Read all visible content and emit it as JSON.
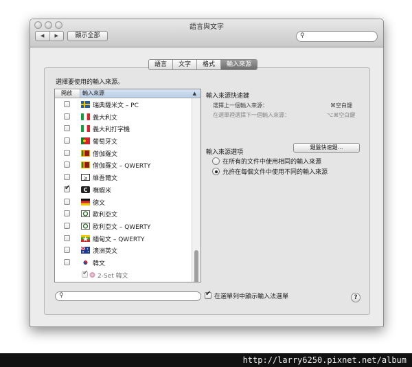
{
  "window": {
    "title": "語言與文字"
  },
  "toolbar": {
    "back_label": "◀",
    "forward_label": "▶",
    "show_all_label": "顯示全部",
    "search_placeholder": ""
  },
  "tabs": [
    "語言",
    "文字",
    "格式",
    "輸入來源"
  ],
  "active_tab": "輸入來源",
  "left": {
    "label": "選擇要使用的輸入來源。",
    "header": {
      "col_enabled": "開啟",
      "col_source": "輸入來源"
    },
    "items": [
      {
        "label": "瑞典薩米文 – PC",
        "checked": false,
        "flag": "sweden-flag"
      },
      {
        "label": "義大利文",
        "checked": false,
        "flag": "italy-flag"
      },
      {
        "label": "義大利打字機",
        "checked": false,
        "flag": "italy-flag"
      },
      {
        "label": "葡萄牙文",
        "checked": false,
        "flag": "portugal-flag"
      },
      {
        "label": "僧伽羅文",
        "checked": false,
        "flag": "sri-lanka-flag"
      },
      {
        "label": "僧伽羅文 – QWERTY",
        "checked": false,
        "flag": "sri-lanka-flag"
      },
      {
        "label": "維吾爾文",
        "checked": false,
        "flag": "uyghur-icon"
      },
      {
        "label": "嘸蝦米",
        "checked": true,
        "flag": "boshiamy-icon"
      },
      {
        "label": "德文",
        "checked": false,
        "flag": "germany-flag"
      },
      {
        "label": "歐利亞文",
        "checked": false,
        "flag": "oriya-icon"
      },
      {
        "label": "歐利亞文 – QWERTY",
        "checked": false,
        "flag": "oriya-icon"
      },
      {
        "label": "緬甸文 – QWERTY",
        "checked": false,
        "flag": "myanmar-flag"
      },
      {
        "label": "澳洲英文",
        "checked": false,
        "flag": "australia-flag"
      },
      {
        "label": "韓文",
        "checked": false,
        "flag": "korea-flag"
      },
      {
        "label": "2-Set 韓文",
        "checked": true,
        "flag": "korean-ime-icon",
        "sub": true
      }
    ]
  },
  "shortcuts": {
    "title": "輸入來源快速鍵",
    "prev_label": "選擇上一個輸入來源：",
    "prev_key": "⌘空白鍵",
    "next_label": "在選單裡選擇下一個輸入來源：",
    "next_key": "⌥⌘空白鍵",
    "button_label": "鍵盤快速鍵…"
  },
  "options": {
    "title": "輸入來源選項",
    "radio_same": "在所有的文件中使用相同的輸入來源",
    "radio_diff": "允許在每個文件中使用不同的輸入來源",
    "selected": "radio_diff"
  },
  "bottom": {
    "search_placeholder": "",
    "show_menu_label": "在選單列中顯示輸入法選單",
    "show_menu_checked": true,
    "help_label": "?"
  },
  "watermark": "http://larry6250.pixnet.net/album"
}
